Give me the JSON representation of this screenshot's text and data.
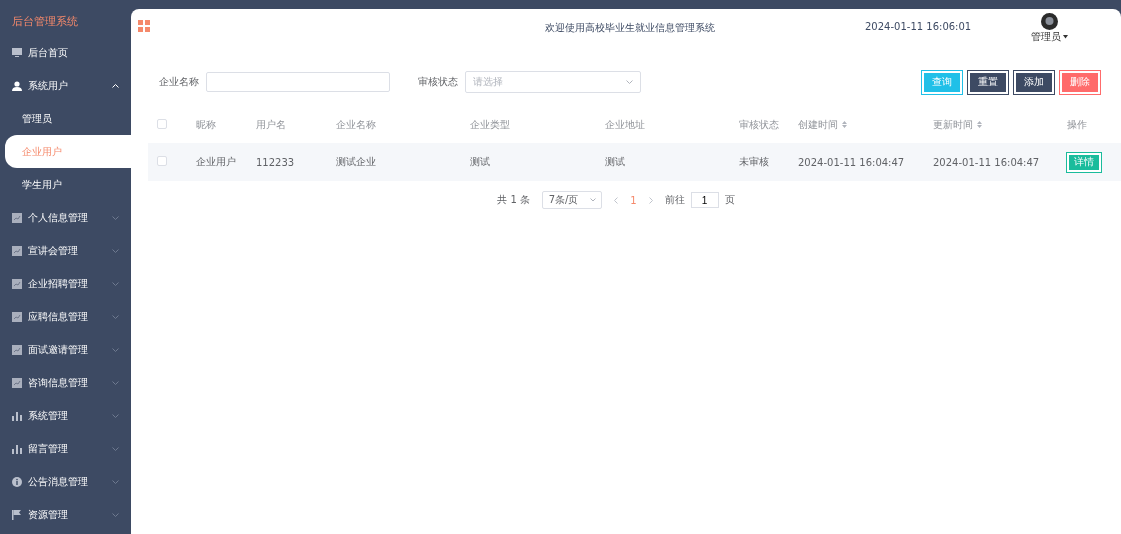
{
  "sidebar": {
    "title": "后台管理系统",
    "items": [
      {
        "label": "后台首页",
        "kind": "monitor"
      },
      {
        "label": "系统用户",
        "kind": "user",
        "expanded": true,
        "children": [
          {
            "label": "管理员",
            "selected": false
          },
          {
            "label": "企业用户",
            "selected": true
          },
          {
            "label": "学生用户",
            "selected": false
          }
        ]
      },
      {
        "label": "个人信息管理",
        "kind": "chart",
        "expanded": false
      },
      {
        "label": "宣讲会管理",
        "kind": "chart",
        "expanded": false
      },
      {
        "label": "企业招聘管理",
        "kind": "chart",
        "expanded": false
      },
      {
        "label": "应聘信息管理",
        "kind": "chart",
        "expanded": false
      },
      {
        "label": "面试邀请管理",
        "kind": "chart",
        "expanded": false
      },
      {
        "label": "咨询信息管理",
        "kind": "chart",
        "expanded": false
      },
      {
        "label": "系统管理",
        "kind": "bars",
        "expanded": false
      },
      {
        "label": "留言管理",
        "kind": "bars",
        "expanded": false
      },
      {
        "label": "公告消息管理",
        "kind": "info",
        "expanded": false
      },
      {
        "label": "资源管理",
        "kind": "flag",
        "expanded": false
      }
    ]
  },
  "header": {
    "title": "欢迎使用高校毕业生就业信息管理系统",
    "datetime": "2024-01-11 16:06:01",
    "user": "管理员"
  },
  "filters": [
    {
      "label": "企业名称",
      "kind": "text"
    },
    {
      "label": "审核状态",
      "kind": "select",
      "placeholder": "请选择"
    }
  ],
  "buttons": [
    {
      "label": "查询",
      "kind": "query"
    },
    {
      "label": "重置",
      "kind": "dark"
    },
    {
      "label": "添加",
      "kind": "dark"
    },
    {
      "label": "删除",
      "kind": "danger"
    }
  ],
  "table": {
    "all_checked": false,
    "columns": [
      {
        "label": "昵称",
        "sortable": false
      },
      {
        "label": "用户名",
        "sortable": false
      },
      {
        "label": "企业名称",
        "sortable": false
      },
      {
        "label": "企业类型",
        "sortable": false
      },
      {
        "label": "企业地址",
        "sortable": false
      },
      {
        "label": "审核状态",
        "sortable": false
      },
      {
        "label": "创建时间",
        "sortable": true
      },
      {
        "label": "更新时间",
        "sortable": true
      },
      {
        "label": "操作",
        "sortable": false
      }
    ],
    "rows": [
      {
        "checked": false,
        "cells": [
          "企业用户",
          "112233",
          "测试企业",
          "测试",
          "测试",
          "未审核",
          "2024-01-11 16:04:47",
          "2024-01-11 16:04:47"
        ],
        "action": "详情"
      }
    ]
  },
  "pagination": {
    "total": "共 1 条",
    "page_size": "7条/页",
    "pages": [
      {
        "label": "1",
        "selected": true
      }
    ],
    "goto_label": "前往",
    "goto_value": "1",
    "goto_suffix": "页"
  }
}
